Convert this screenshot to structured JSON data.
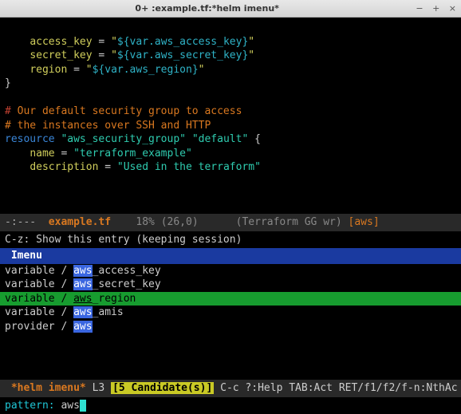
{
  "window": {
    "title": "0+  :example.tf:*helm imenu*",
    "min": "−",
    "max": "+",
    "close": "×"
  },
  "code": {
    "l1_indent": "    ",
    "l1_key": "access_key",
    "l1_eq": " = ",
    "l1_q": "\"",
    "l1_val": "${var.aws_access_key}",
    "l2_key": "secret_key",
    "l2_val": "${var.aws_secret_key}",
    "l3_key": "region",
    "l3_val": "${var.aws_region}",
    "brace_close": "}",
    "blank": "",
    "c1a": "#",
    "c1b": " Our default security group to access",
    "c2": "# the instances over SSH and HTTP",
    "res_kw": "resource",
    "res_sp": " ",
    "res_type": "\"aws_security_group\"",
    "res_name": "\"default\"",
    "res_open": " {",
    "name_indent": "    ",
    "name_key": "name",
    "name_val": "\"terraform_example\"",
    "desc_key": "description",
    "desc_val": "\"Used in the terraform\""
  },
  "modeline": {
    "left": "-:---  ",
    "file": "example.tf",
    "spacer": "    ",
    "pos": "18% (26,0)",
    "spacer2": "      ",
    "mode_open": "(",
    "mode": "Terraform GG wr",
    "mode_close": ") ",
    "br_open": "[",
    "aws": "aws",
    "br_close": "]"
  },
  "hint": "C-z: Show this entry (keeping session)",
  "imenu_header": "Imenu",
  "candidates": [
    {
      "prefix": "variable / ",
      "match": "aws",
      "rest": "_access_key",
      "selected": false
    },
    {
      "prefix": "variable / ",
      "match": "aws",
      "rest": "_secret_key",
      "selected": false
    },
    {
      "prefix": "variable / ",
      "match": "aws",
      "rest": "_region",
      "selected": true
    },
    {
      "prefix": "variable / ",
      "match": "aws",
      "rest": "_amis",
      "selected": false
    },
    {
      "prefix": "provider / ",
      "match": "aws",
      "rest": "",
      "selected": false
    }
  ],
  "helm_modeline": {
    "spacer": " ",
    "name": "*helm imenu*",
    "line": " L3 ",
    "count": "[5 Candidate(s)]",
    "help": " C-c ?:Help TAB:Act RET/f1/f2/f-n:NthAc"
  },
  "pattern": {
    "label": "pattern: ",
    "text": "aws"
  }
}
